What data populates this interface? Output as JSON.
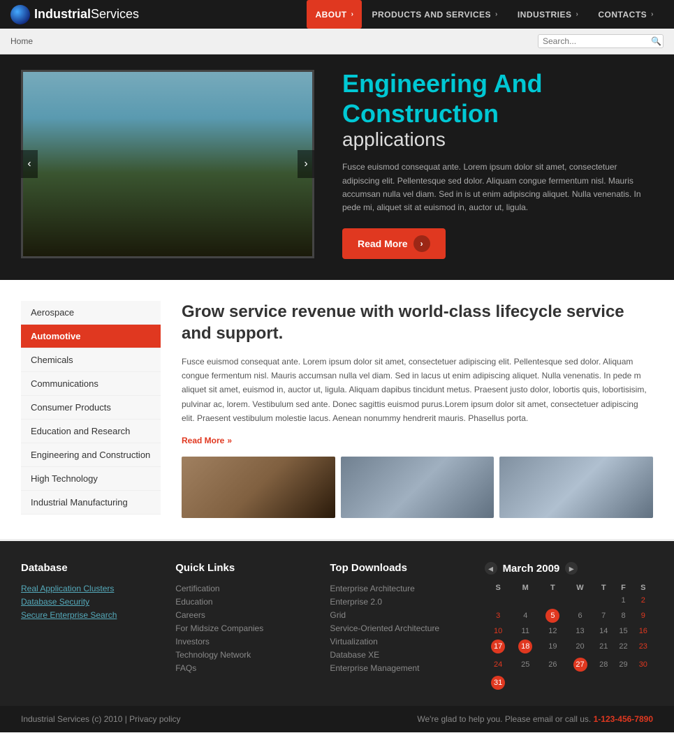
{
  "header": {
    "logo_bold": "Industrial",
    "logo_light": "Services",
    "nav": [
      {
        "label": "ABOUT",
        "active": true
      },
      {
        "label": "PRODUCTS AND SERVICES",
        "active": false
      },
      {
        "label": "INDUSTRIES",
        "active": false
      },
      {
        "label": "CONTACTS",
        "active": false
      }
    ]
  },
  "breadcrumb": {
    "home": "Home",
    "search_placeholder": "Search..."
  },
  "hero": {
    "title_colored": "Engineering And Construction",
    "title_white": "applications",
    "description": "Fusce euismod consequat ante. Lorem ipsum dolor sit amet, consectetuer adipiscing elit. Pellentesque sed dolor. Aliquam congue fermentum nisl. Mauris accumsan nulla vel diam. Sed in is ut enim adipiscing aliquet. Nulla venenatis. In pede mi, aliquet sit at euismod in, auctor ut, ligula.",
    "read_more": "Read More",
    "prev_arrow": "‹",
    "next_arrow": "›"
  },
  "sidebar": {
    "items": [
      {
        "label": "Aerospace",
        "active": false
      },
      {
        "label": "Automotive",
        "active": true
      },
      {
        "label": "Chemicals",
        "active": false
      },
      {
        "label": "Communications",
        "active": false
      },
      {
        "label": "Consumer Products",
        "active": false
      },
      {
        "label": "Education and Research",
        "active": false
      },
      {
        "label": "Engineering and Construction",
        "active": false
      },
      {
        "label": "High Technology",
        "active": false
      },
      {
        "label": "Industrial Manufacturing",
        "active": false
      }
    ]
  },
  "main": {
    "title": "Grow service revenue with world-class lifecycle service and support.",
    "description": "Fusce euismod consequat ante. Lorem ipsum dolor sit amet, consectetuer adipiscing elit. Pellentesque sed dolor. Aliquam congue fermentum nisl. Mauris accumsan nulla vel diam. Sed in lacus ut enim adipiscing aliquet. Nulla venenatis. In pede m aliquet sit amet, euismod in, auctor ut, ligula. Aliquam dapibus tincidunt metus. Praesent justo dolor, lobortis quis, lobortisisim, pulvinar ac, lorem. Vestibulum sed ante. Donec sagittis euismod purus.Lorem ipsum dolor sit amet, consectetuer adipiscing elit. Praesent vestibulum molestie lacus. Aenean nonummy hendrerit mauris. Phasellus porta.",
    "read_more": "Read More"
  },
  "footer": {
    "database": {
      "title": "Database",
      "links": [
        "Real Application Clusters",
        "Database Security",
        "Secure Enterprise Search"
      ]
    },
    "quick_links": {
      "title": "Quick Links",
      "items": [
        "Certification",
        "Education",
        "Careers",
        "For Midsize Companies",
        "Investors",
        "Technology Network",
        "FAQs"
      ]
    },
    "top_downloads": {
      "title": "Top Downloads",
      "items": [
        "Enterprise Architecture",
        "Enterprise 2.0",
        "Grid",
        "Service-Oriented Architecture",
        "Virtualization",
        "Database XE",
        "Enterprise Management"
      ]
    },
    "calendar": {
      "title": "March 2009",
      "days_header": [
        "S",
        "M",
        "T",
        "W",
        "T",
        "F",
        "S"
      ],
      "weeks": [
        [
          "",
          "",
          "",
          "",
          "",
          "",
          "1",
          "2"
        ],
        [
          "3",
          "4",
          "5",
          "6",
          "7",
          "8",
          "9"
        ],
        [
          "10",
          "11",
          "12",
          "13",
          "14",
          "15",
          "16"
        ],
        [
          "17",
          "18",
          "19",
          "20",
          "21",
          "22",
          "23"
        ],
        [
          "24",
          "25",
          "26",
          "27",
          "28",
          "29",
          "30"
        ],
        [
          "31",
          "",
          "",
          "",
          "",
          "",
          ""
        ]
      ],
      "highlighted": [
        "5",
        "17",
        "18",
        "27",
        "31"
      ]
    },
    "bottom": {
      "left": "Industrial Services (c) 2010  |  Privacy policy",
      "right_text": "We're glad to help you. Please email or call us.",
      "phone": "1-123-456-7890"
    }
  }
}
